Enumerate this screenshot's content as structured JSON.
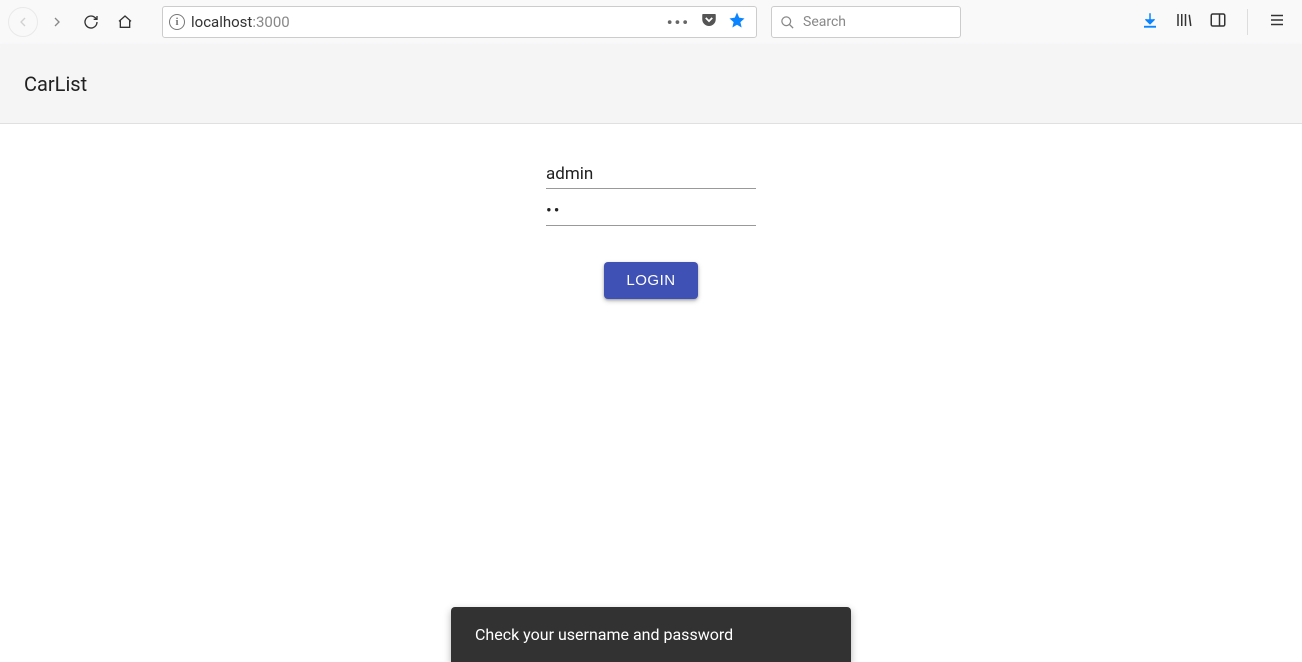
{
  "browser": {
    "url_host": "localhost",
    "url_port": ":3000",
    "search_placeholder": "Search"
  },
  "app": {
    "title": "CarList"
  },
  "login": {
    "username_value": "admin",
    "password_value": "••",
    "button_label": "LOGIN"
  },
  "snackbar": {
    "message": "Check your username and password"
  }
}
